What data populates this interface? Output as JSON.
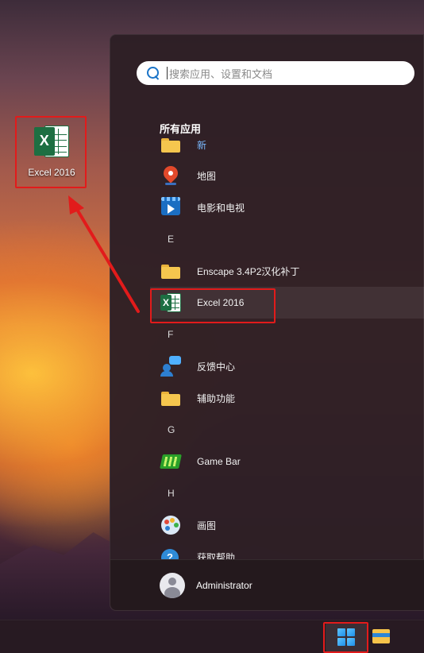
{
  "desktop": {
    "icon_label": "Excel 2016"
  },
  "start_menu": {
    "search_placeholder": "搜索应用、设置和文档",
    "section_title": "所有应用",
    "items": [
      {
        "type": "app",
        "label": "新",
        "icon": "folder-icon"
      },
      {
        "type": "app",
        "label": "地图",
        "icon": "map-pin-icon"
      },
      {
        "type": "app",
        "label": "电影和电视",
        "icon": "movies-tv-icon"
      },
      {
        "type": "letter",
        "label": "E"
      },
      {
        "type": "app",
        "label": "Enscape 3.4P2汉化补丁",
        "icon": "folder-icon"
      },
      {
        "type": "app",
        "label": "Excel 2016",
        "icon": "excel-icon",
        "selected": true
      },
      {
        "type": "letter",
        "label": "F"
      },
      {
        "type": "app",
        "label": "反馈中心",
        "icon": "feedback-hub-icon"
      },
      {
        "type": "app",
        "label": "辅助功能",
        "icon": "folder-icon"
      },
      {
        "type": "letter",
        "label": "G"
      },
      {
        "type": "app",
        "label": "Game Bar",
        "icon": "game-bar-icon"
      },
      {
        "type": "letter",
        "label": "H"
      },
      {
        "type": "app",
        "label": "画图",
        "icon": "paint-icon"
      },
      {
        "type": "app",
        "label": "获取帮助",
        "icon": "get-help-icon"
      }
    ],
    "user_name": "Administrator"
  },
  "excel_glyph": "X",
  "colors": {
    "highlight_box": "#e21b1b",
    "excel_green": "#1d6f42",
    "panel_bg": "#2d1f25",
    "accent_blue": "#1a74c8"
  }
}
